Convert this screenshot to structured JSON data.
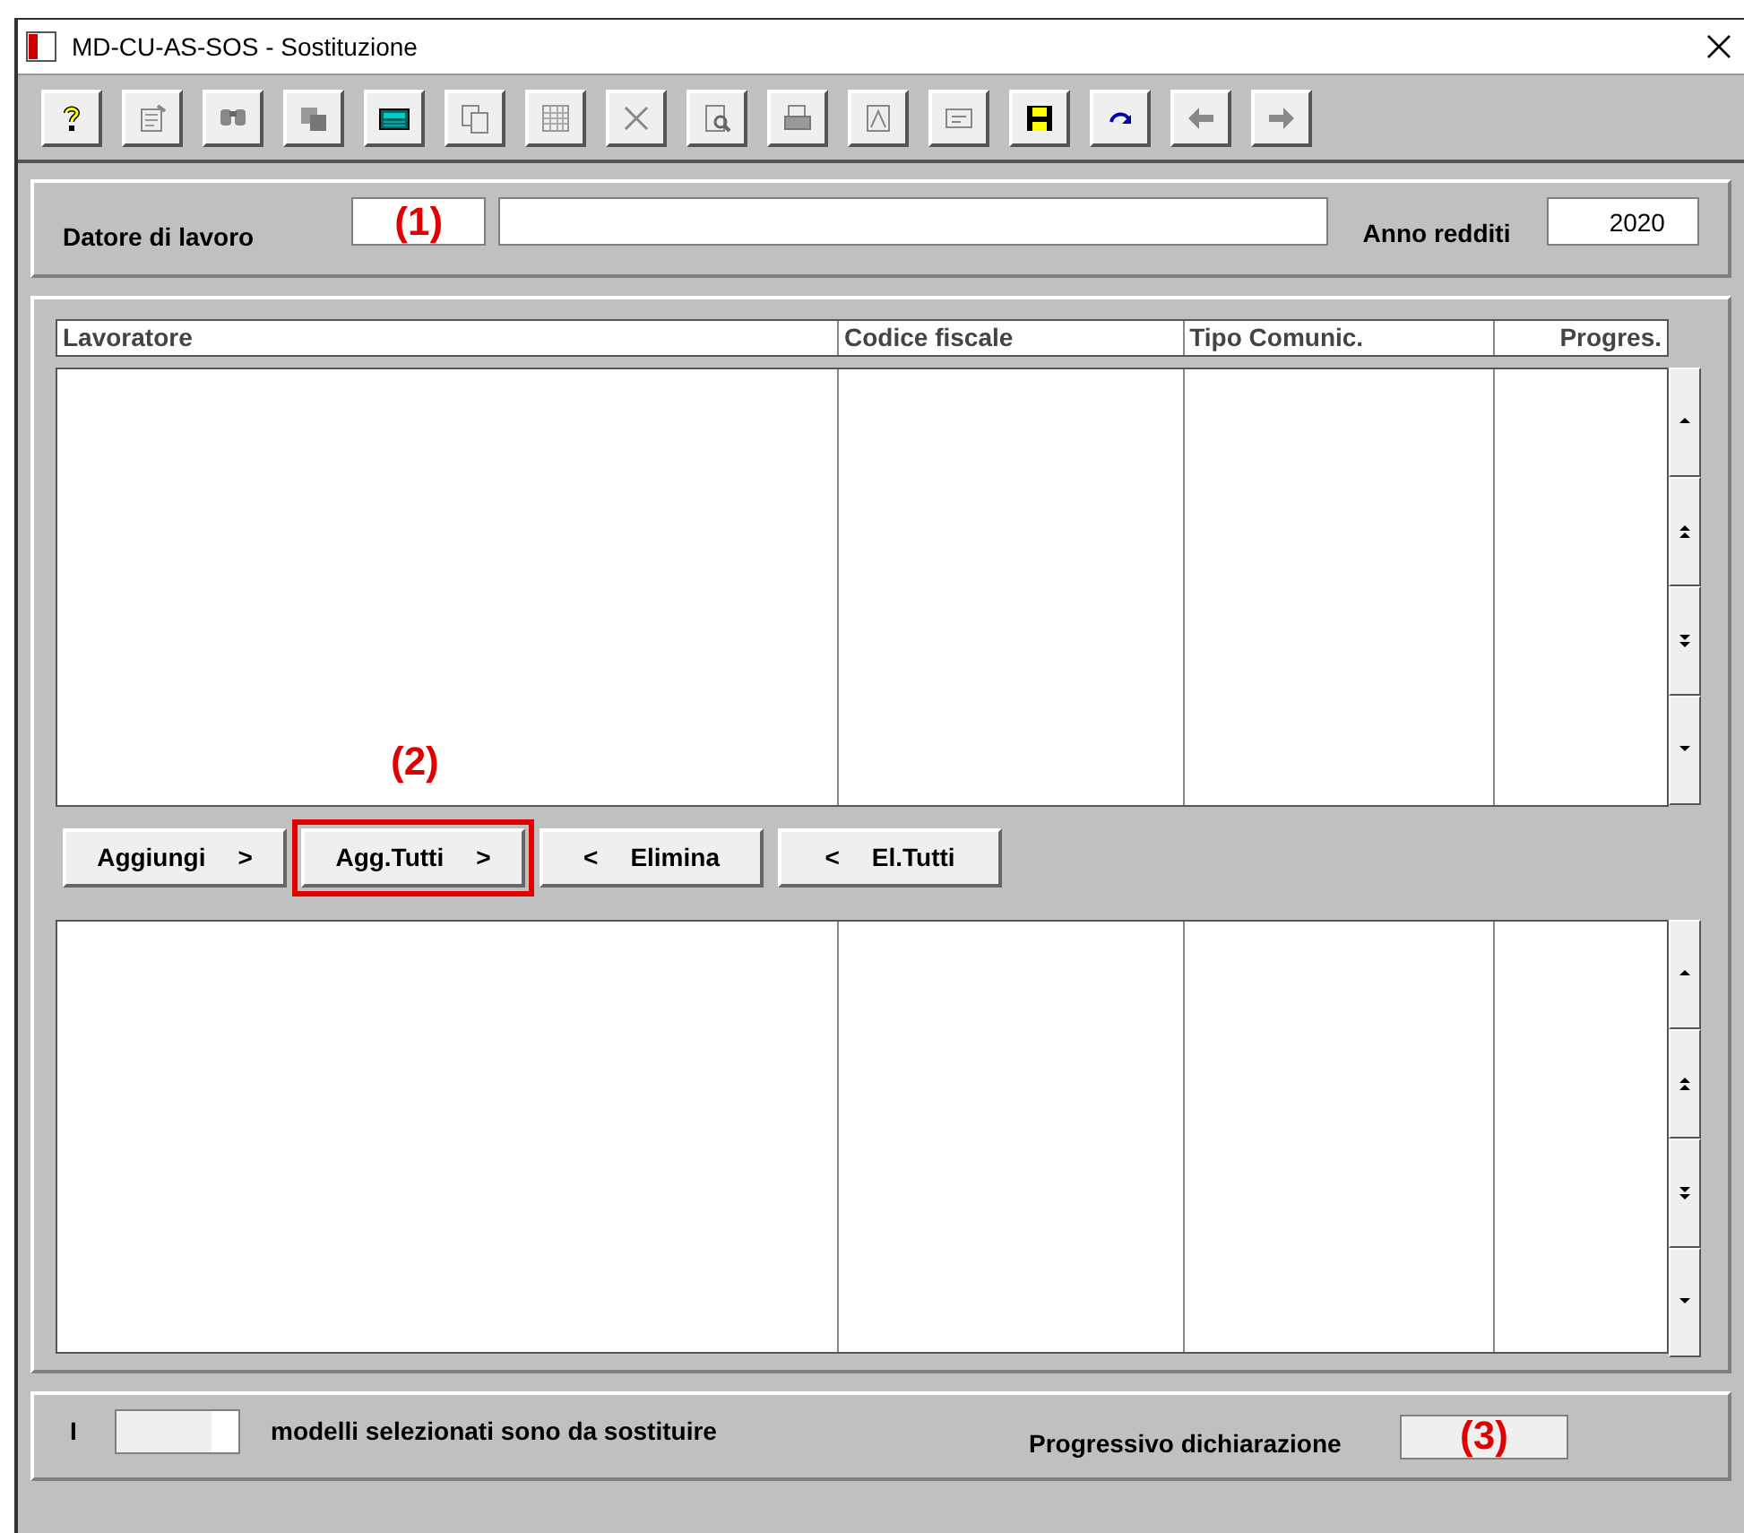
{
  "window": {
    "title": "MD-CU-AS-SOS - Sostituzione"
  },
  "toolbar": [
    {
      "kind": "help"
    },
    {
      "kind": "properties"
    },
    {
      "kind": "binoculars"
    },
    {
      "kind": "layers"
    },
    {
      "kind": "calculator"
    },
    {
      "kind": "copy"
    },
    {
      "kind": "grid"
    },
    {
      "kind": "delete"
    },
    {
      "kind": "preview"
    },
    {
      "kind": "printer"
    },
    {
      "kind": "pdf"
    },
    {
      "kind": "note"
    },
    {
      "kind": "save"
    },
    {
      "kind": "redo"
    },
    {
      "kind": "back"
    },
    {
      "kind": "forward"
    }
  ],
  "header": {
    "employer_label": "Datore di lavoro",
    "employer_code": {
      "annotation": "(1)"
    },
    "year_label": "Anno redditi",
    "year": "2020"
  },
  "upper_list": {
    "columns": [
      "Lavoratore",
      "Codice fiscale",
      "Tipo Comunic.",
      "Progres."
    ],
    "scroll_buttons": [
      {
        "kind": "up"
      },
      {
        "kind": "page-up"
      },
      {
        "kind": "page-down"
      },
      {
        "kind": "down"
      }
    ]
  },
  "annotation_2": "(2)",
  "buttons": [
    {
      "label": "Aggiungi",
      "arrow": ">",
      "kind": "add",
      "highlighted": false
    },
    {
      "label": "Agg.Tutti",
      "arrow": ">",
      "kind": "add",
      "highlighted": true
    },
    {
      "label": "Elimina",
      "arrow": "<",
      "kind": "remove",
      "highlighted": false
    },
    {
      "label": "El.Tutti",
      "arrow": "<",
      "kind": "remove",
      "highlighted": false
    }
  ],
  "lower_list": {
    "scroll_buttons": [
      {
        "kind": "up"
      },
      {
        "kind": "page-up"
      },
      {
        "kind": "page-down"
      },
      {
        "kind": "down"
      }
    ]
  },
  "footer": {
    "prefix": "I",
    "text": "modelli selezionati sono da sostituire",
    "progressive_label": "Progressivo dichiarazione",
    "progressive": {
      "annotation": "(3)"
    }
  }
}
